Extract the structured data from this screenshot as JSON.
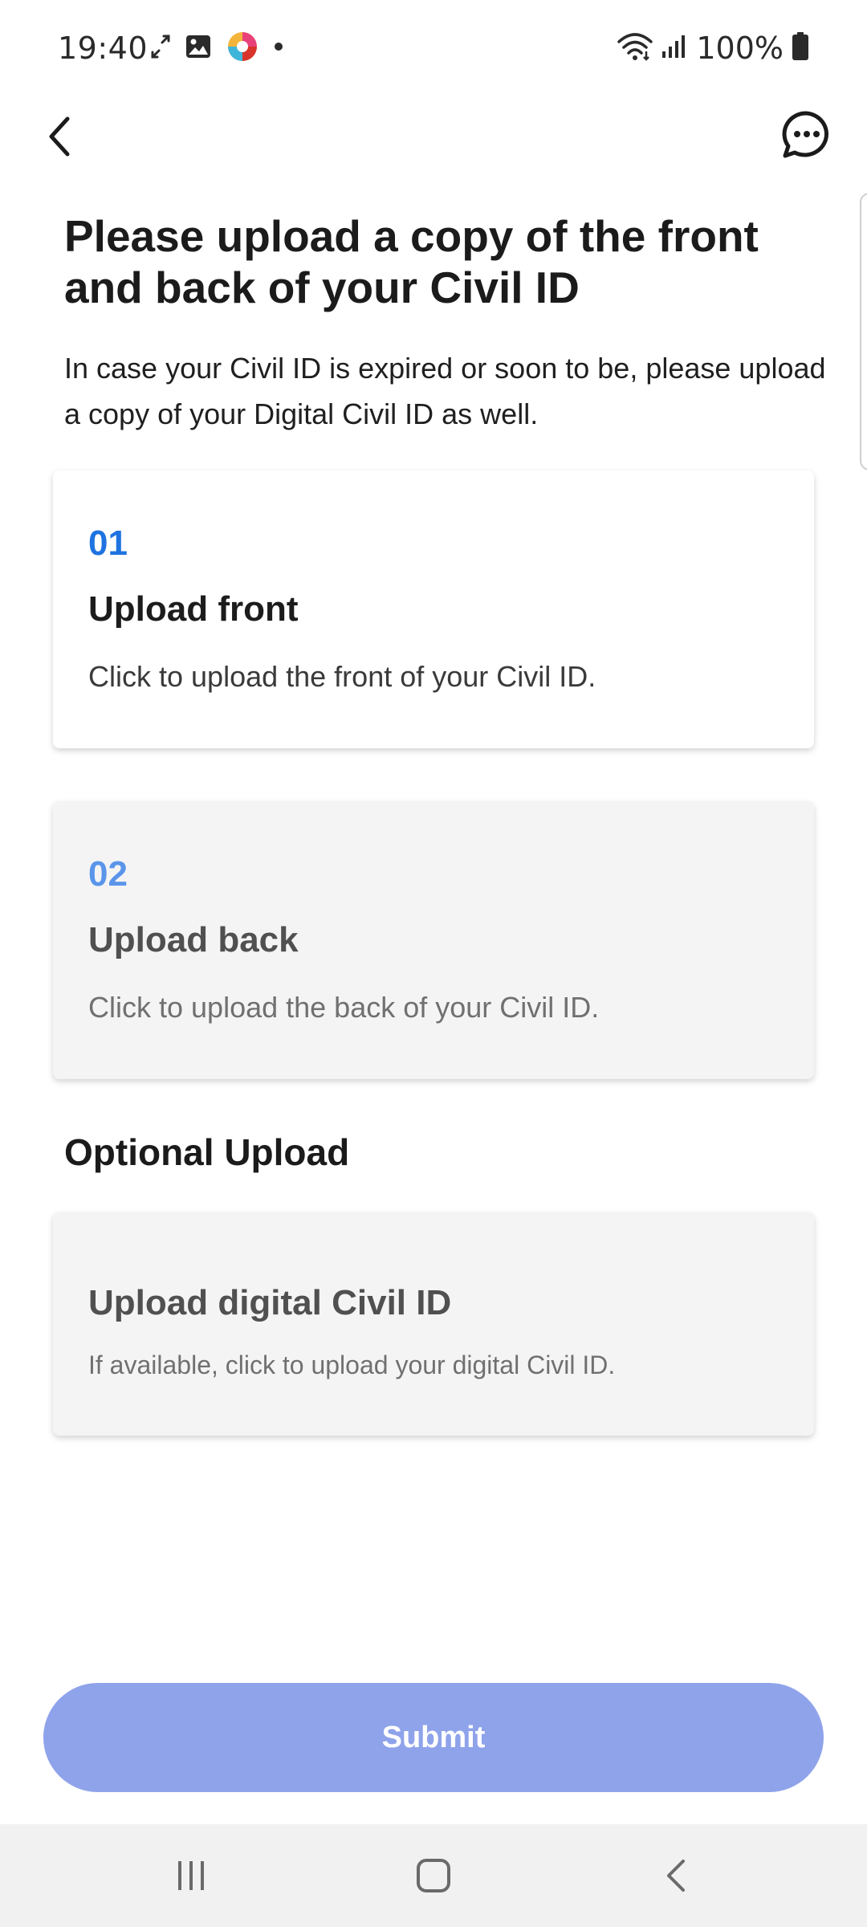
{
  "status_bar": {
    "time": "19:40",
    "battery": "100%",
    "left_icons": [
      "sync-icon",
      "gallery-icon",
      "app-logo-icon",
      "dot-icon"
    ],
    "right_icons": [
      "wifi-icon",
      "signal-icon",
      "battery-icon"
    ]
  },
  "app_bar": {
    "back_icon": "chevron-left-icon",
    "chat_icon": "chat-bubble-icon"
  },
  "page": {
    "title": "Please upload a copy of the front and back of your Civil ID",
    "description": "In case your Civil ID is expired or soon to be, please upload a copy of your Digital Civil ID as well."
  },
  "cards": {
    "front": {
      "number": "01",
      "title": "Upload front",
      "description": "Click to upload the front of your Civil ID."
    },
    "back": {
      "number": "02",
      "title": "Upload back",
      "description": "Click to upload the back of your Civil ID."
    },
    "digital": {
      "title": "Upload digital Civil ID",
      "description": "If available, click to upload your digital Civil ID."
    }
  },
  "optional_section": {
    "label": "Optional Upload"
  },
  "submit": {
    "label": "Submit"
  },
  "colors": {
    "accent_blue": "#1f73e0",
    "submit_disabled": "#8fa3eb",
    "card_disabled_bg": "#f4f4f4",
    "nav_bar_bg": "#f1f1f1"
  },
  "nav_bar": {
    "icons": [
      "recent-apps-icon",
      "home-icon",
      "back-icon"
    ]
  }
}
